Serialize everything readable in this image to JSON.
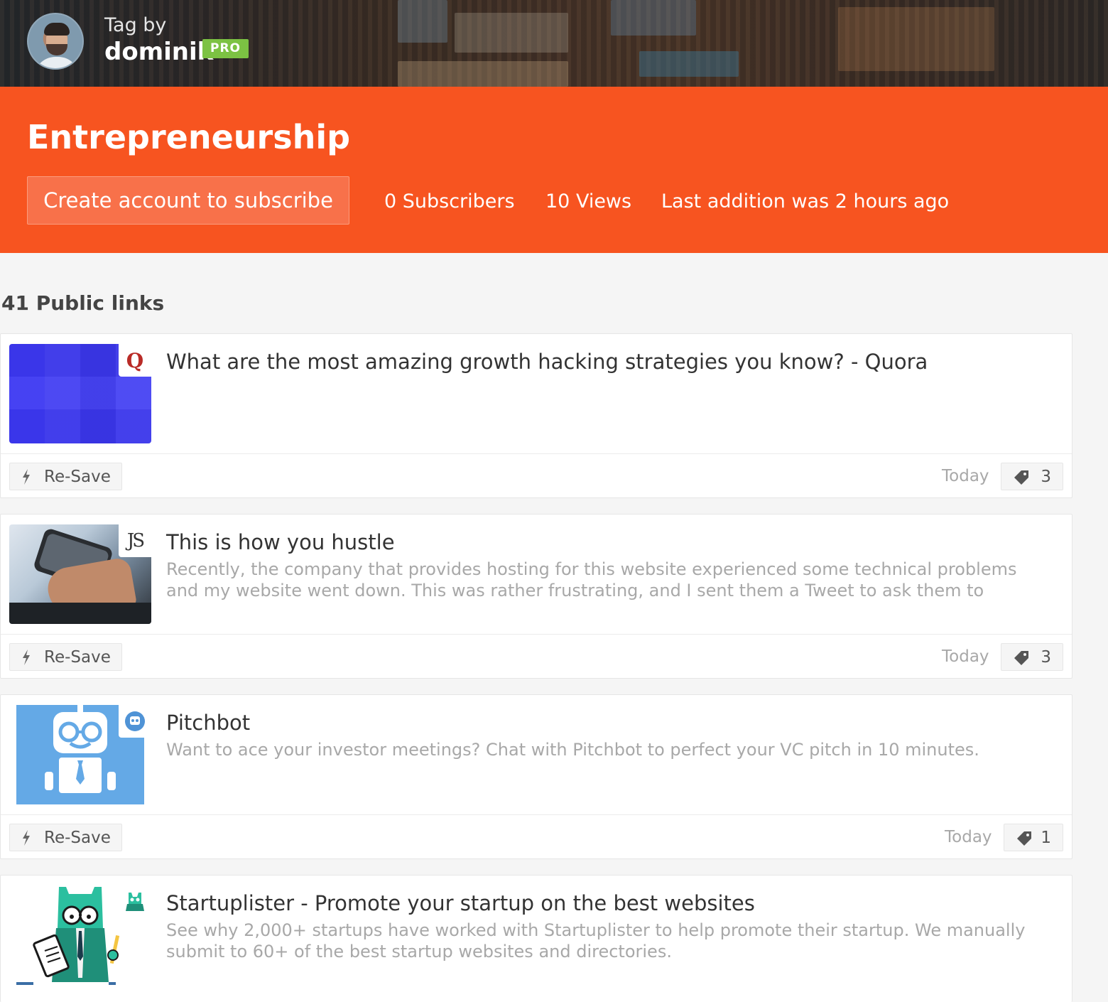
{
  "banner": {
    "tag_by_label": "Tag by",
    "owner_name": "dominik",
    "pro_badge": "PRO"
  },
  "hero": {
    "title": "Entrepreneurship",
    "subscribe_button": "Create account to subscribe",
    "subscribers": "0 Subscribers",
    "views": "10 Views",
    "last_addition": "Last addition was 2 hours ago"
  },
  "links_count": "41 Public links",
  "resave_label": "Re-Save",
  "colors": {
    "accent": "#f75420",
    "pro_badge": "#7cc243"
  },
  "links": [
    {
      "title": "What are the most amazing growth hacking strategies you know? - Quora",
      "description": "",
      "favicon": "Q",
      "date": "Today",
      "tags": "3"
    },
    {
      "title": "This is how you hustle",
      "description": "Recently, the company that provides hosting for this website experienced some technical problems and my website went down. This was rather frustrating, and I sent them a Tweet to ask them to",
      "favicon": "JS",
      "date": "Today",
      "tags": "3"
    },
    {
      "title": "Pitchbot",
      "description": "Want to ace your investor meetings? Chat with Pitchbot to perfect your VC pitch in 10 minutes.",
      "favicon": "robot-icon",
      "date": "Today",
      "tags": "1"
    },
    {
      "title": "Startuplister - Promote your startup on the best websites",
      "description": "See why 2,000+ startups have worked with Startuplister to help promote their startup. We manually submit to 60+ of the best startup websites and directories.",
      "favicon": "cat-icon",
      "date": "",
      "tags": ""
    }
  ]
}
